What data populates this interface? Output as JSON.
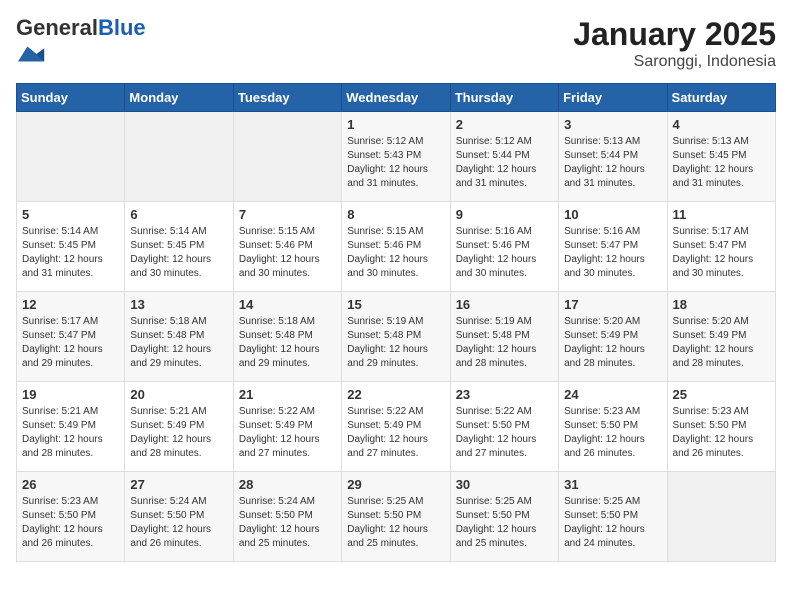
{
  "logo": {
    "general": "General",
    "blue": "Blue"
  },
  "title": "January 2025",
  "subtitle": "Saronggi, Indonesia",
  "days_of_week": [
    "Sunday",
    "Monday",
    "Tuesday",
    "Wednesday",
    "Thursday",
    "Friday",
    "Saturday"
  ],
  "weeks": [
    [
      {
        "day": "",
        "sunrise": "",
        "sunset": "",
        "daylight": "",
        "empty": true
      },
      {
        "day": "",
        "sunrise": "",
        "sunset": "",
        "daylight": "",
        "empty": true
      },
      {
        "day": "",
        "sunrise": "",
        "sunset": "",
        "daylight": "",
        "empty": true
      },
      {
        "day": "1",
        "sunrise": "Sunrise: 5:12 AM",
        "sunset": "Sunset: 5:43 PM",
        "daylight": "Daylight: 12 hours and 31 minutes."
      },
      {
        "day": "2",
        "sunrise": "Sunrise: 5:12 AM",
        "sunset": "Sunset: 5:44 PM",
        "daylight": "Daylight: 12 hours and 31 minutes."
      },
      {
        "day": "3",
        "sunrise": "Sunrise: 5:13 AM",
        "sunset": "Sunset: 5:44 PM",
        "daylight": "Daylight: 12 hours and 31 minutes."
      },
      {
        "day": "4",
        "sunrise": "Sunrise: 5:13 AM",
        "sunset": "Sunset: 5:45 PM",
        "daylight": "Daylight: 12 hours and 31 minutes."
      }
    ],
    [
      {
        "day": "5",
        "sunrise": "Sunrise: 5:14 AM",
        "sunset": "Sunset: 5:45 PM",
        "daylight": "Daylight: 12 hours and 31 minutes."
      },
      {
        "day": "6",
        "sunrise": "Sunrise: 5:14 AM",
        "sunset": "Sunset: 5:45 PM",
        "daylight": "Daylight: 12 hours and 30 minutes."
      },
      {
        "day": "7",
        "sunrise": "Sunrise: 5:15 AM",
        "sunset": "Sunset: 5:46 PM",
        "daylight": "Daylight: 12 hours and 30 minutes."
      },
      {
        "day": "8",
        "sunrise": "Sunrise: 5:15 AM",
        "sunset": "Sunset: 5:46 PM",
        "daylight": "Daylight: 12 hours and 30 minutes."
      },
      {
        "day": "9",
        "sunrise": "Sunrise: 5:16 AM",
        "sunset": "Sunset: 5:46 PM",
        "daylight": "Daylight: 12 hours and 30 minutes."
      },
      {
        "day": "10",
        "sunrise": "Sunrise: 5:16 AM",
        "sunset": "Sunset: 5:47 PM",
        "daylight": "Daylight: 12 hours and 30 minutes."
      },
      {
        "day": "11",
        "sunrise": "Sunrise: 5:17 AM",
        "sunset": "Sunset: 5:47 PM",
        "daylight": "Daylight: 12 hours and 30 minutes."
      }
    ],
    [
      {
        "day": "12",
        "sunrise": "Sunrise: 5:17 AM",
        "sunset": "Sunset: 5:47 PM",
        "daylight": "Daylight: 12 hours and 29 minutes."
      },
      {
        "day": "13",
        "sunrise": "Sunrise: 5:18 AM",
        "sunset": "Sunset: 5:48 PM",
        "daylight": "Daylight: 12 hours and 29 minutes."
      },
      {
        "day": "14",
        "sunrise": "Sunrise: 5:18 AM",
        "sunset": "Sunset: 5:48 PM",
        "daylight": "Daylight: 12 hours and 29 minutes."
      },
      {
        "day": "15",
        "sunrise": "Sunrise: 5:19 AM",
        "sunset": "Sunset: 5:48 PM",
        "daylight": "Daylight: 12 hours and 29 minutes."
      },
      {
        "day": "16",
        "sunrise": "Sunrise: 5:19 AM",
        "sunset": "Sunset: 5:48 PM",
        "daylight": "Daylight: 12 hours and 28 minutes."
      },
      {
        "day": "17",
        "sunrise": "Sunrise: 5:20 AM",
        "sunset": "Sunset: 5:49 PM",
        "daylight": "Daylight: 12 hours and 28 minutes."
      },
      {
        "day": "18",
        "sunrise": "Sunrise: 5:20 AM",
        "sunset": "Sunset: 5:49 PM",
        "daylight": "Daylight: 12 hours and 28 minutes."
      }
    ],
    [
      {
        "day": "19",
        "sunrise": "Sunrise: 5:21 AM",
        "sunset": "Sunset: 5:49 PM",
        "daylight": "Daylight: 12 hours and 28 minutes."
      },
      {
        "day": "20",
        "sunrise": "Sunrise: 5:21 AM",
        "sunset": "Sunset: 5:49 PM",
        "daylight": "Daylight: 12 hours and 28 minutes."
      },
      {
        "day": "21",
        "sunrise": "Sunrise: 5:22 AM",
        "sunset": "Sunset: 5:49 PM",
        "daylight": "Daylight: 12 hours and 27 minutes."
      },
      {
        "day": "22",
        "sunrise": "Sunrise: 5:22 AM",
        "sunset": "Sunset: 5:49 PM",
        "daylight": "Daylight: 12 hours and 27 minutes."
      },
      {
        "day": "23",
        "sunrise": "Sunrise: 5:22 AM",
        "sunset": "Sunset: 5:50 PM",
        "daylight": "Daylight: 12 hours and 27 minutes."
      },
      {
        "day": "24",
        "sunrise": "Sunrise: 5:23 AM",
        "sunset": "Sunset: 5:50 PM",
        "daylight": "Daylight: 12 hours and 26 minutes."
      },
      {
        "day": "25",
        "sunrise": "Sunrise: 5:23 AM",
        "sunset": "Sunset: 5:50 PM",
        "daylight": "Daylight: 12 hours and 26 minutes."
      }
    ],
    [
      {
        "day": "26",
        "sunrise": "Sunrise: 5:23 AM",
        "sunset": "Sunset: 5:50 PM",
        "daylight": "Daylight: 12 hours and 26 minutes."
      },
      {
        "day": "27",
        "sunrise": "Sunrise: 5:24 AM",
        "sunset": "Sunset: 5:50 PM",
        "daylight": "Daylight: 12 hours and 26 minutes."
      },
      {
        "day": "28",
        "sunrise": "Sunrise: 5:24 AM",
        "sunset": "Sunset: 5:50 PM",
        "daylight": "Daylight: 12 hours and 25 minutes."
      },
      {
        "day": "29",
        "sunrise": "Sunrise: 5:25 AM",
        "sunset": "Sunset: 5:50 PM",
        "daylight": "Daylight: 12 hours and 25 minutes."
      },
      {
        "day": "30",
        "sunrise": "Sunrise: 5:25 AM",
        "sunset": "Sunset: 5:50 PM",
        "daylight": "Daylight: 12 hours and 25 minutes."
      },
      {
        "day": "31",
        "sunrise": "Sunrise: 5:25 AM",
        "sunset": "Sunset: 5:50 PM",
        "daylight": "Daylight: 12 hours and 24 minutes."
      },
      {
        "day": "",
        "sunrise": "",
        "sunset": "",
        "daylight": "",
        "empty": true
      }
    ]
  ]
}
